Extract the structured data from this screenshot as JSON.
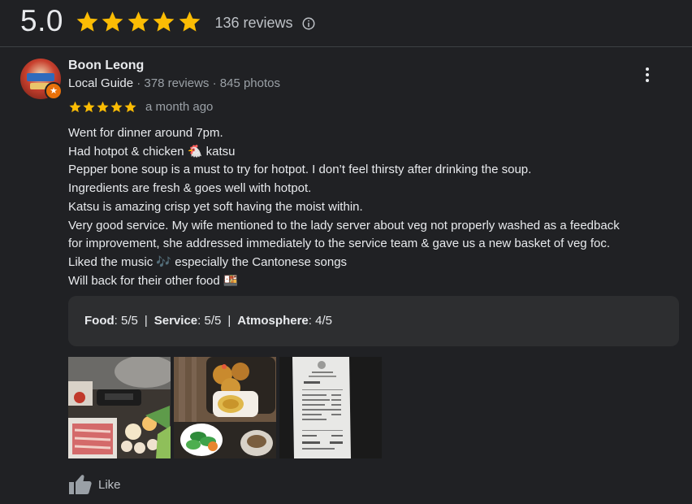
{
  "summary": {
    "score": "5.0",
    "star_count": 5,
    "review_count": "136 reviews",
    "star_color": "#fbbc04"
  },
  "review": {
    "reviewer_name": "Boon Leong",
    "guide_label": "Local Guide",
    "reviewer_stats": " · 378 reviews · 845 photos",
    "rating": 5,
    "date": "a month ago",
    "text_lines": [
      "Went for dinner around 7pm.",
      "Had hotpot & chicken 🐔 katsu",
      "Pepper bone soup is a must to try for hotpot. I don’t feel thirsty after drinking the soup.",
      "Ingredients are fresh & goes well with hotpot.",
      "Katsu is amazing crisp yet soft having the moist within.",
      "Very good service. My wife mentioned to the lady server about veg not properly washed as a feedback",
      "for improvement, she addressed immediately to the service team & gave us a new basket of veg foc.",
      "Liked the music 🎶 especially the Cantonese songs",
      "Will back for their other food 🍱"
    ],
    "attributes": {
      "food_label": "Food",
      "food_value": ": 5/5",
      "service_label": "Service",
      "service_value": ": 5/5",
      "atmosphere_label": "Atmosphere",
      "atmosphere_value": ": 4/5",
      "separator": "|"
    },
    "like_label": "Like"
  },
  "icons": {
    "info": "info-icon",
    "more": "more-vert-icon",
    "like": "thumb-up-icon",
    "badge": "local-guide-star-icon"
  },
  "colors": {
    "background": "#202124",
    "panel": "#2d2e30",
    "badge": "#e8710a"
  }
}
